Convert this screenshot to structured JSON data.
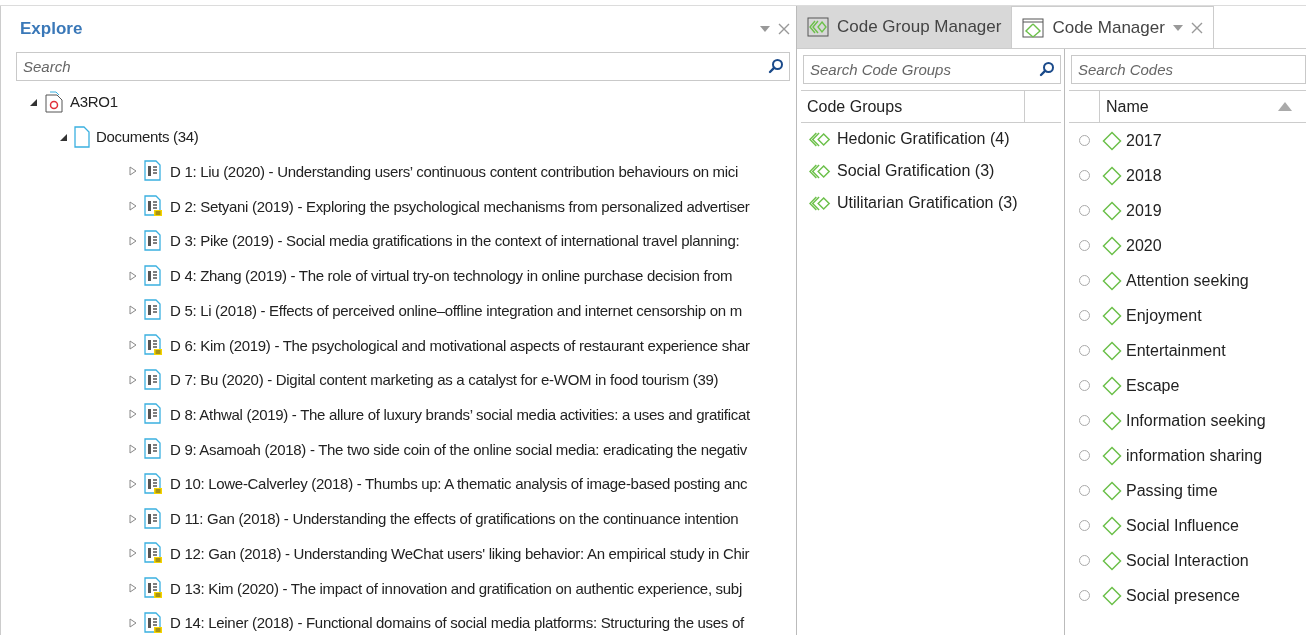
{
  "explore": {
    "title": "Explore",
    "search": {
      "placeholder": "Search"
    },
    "tree": [
      {
        "label": "A3RO1",
        "kind": "project",
        "expanded": true,
        "children": [
          {
            "label": "Documents (34)",
            "kind": "folder",
            "expanded": true,
            "children": [
              {
                "label": "D 1: Liu (2020) - Understanding users’ continuous content contribution behaviours on mici",
                "kind": "document",
                "expanded": false,
                "has_memo": false
              },
              {
                "label": "D 2: Setyani (2019) - Exploring the psychological mechanisms from personalized advertiser",
                "kind": "document",
                "expanded": false,
                "has_memo": true
              },
              {
                "label": "D 3: Pike (2019) - Social media gratifications in the context of international travel planning:",
                "kind": "document",
                "expanded": false,
                "has_memo": false
              },
              {
                "label": "D 4: Zhang (2019) - The role of virtual try-on technology in online purchase decision from",
                "kind": "document",
                "expanded": false,
                "has_memo": false
              },
              {
                "label": "D 5: Li (2018) - Effects of perceived online–offline integration and internet censorship on m",
                "kind": "document",
                "expanded": false,
                "has_memo": false
              },
              {
                "label": "D 6: Kim (2019) - The psychological and motivational aspects of restaurant experience shar",
                "kind": "document",
                "expanded": false,
                "has_memo": true
              },
              {
                "label": "D 7: Bu (2020) - Digital content marketing as a catalyst for e-WOM in food tourism (39)",
                "kind": "document",
                "expanded": false,
                "has_memo": false
              },
              {
                "label": "D 8: Athwal (2019) - The allure of luxury brands’ social media activities: a uses and gratificat",
                "kind": "document",
                "expanded": false,
                "has_memo": false
              },
              {
                "label": "D 9: Asamoah (2018) - The two side coin of the online social media: eradicating the negativ",
                "kind": "document",
                "expanded": false,
                "has_memo": false
              },
              {
                "label": "D 10: Lowe-Calverley (2018) - Thumbs up: A thematic analysis of image-based posting anc",
                "kind": "document",
                "expanded": false,
                "has_memo": true
              },
              {
                "label": "D 11: Gan (2018) - Understanding the effects of gratifications on the continuance intention",
                "kind": "document",
                "expanded": false,
                "has_memo": false
              },
              {
                "label": "D 12: Gan (2018) - Understanding WeChat users' liking behavior: An empirical study in Chir",
                "kind": "document",
                "expanded": false,
                "has_memo": true
              },
              {
                "label": "D 13: Kim (2020) - The impact of innovation and gratification on authentic experience, subj",
                "kind": "document",
                "expanded": false,
                "has_memo": true
              },
              {
                "label": "D 14: Leiner (2018) - Functional domains of social media platforms: Structuring the uses of",
                "kind": "document",
                "expanded": false,
                "has_memo": true
              }
            ]
          }
        ]
      }
    ]
  },
  "tabs": [
    {
      "label": "Code Group Manager",
      "kind": "groups",
      "selected": false
    },
    {
      "label": "Code Manager",
      "kind": "codes",
      "selected": true
    }
  ],
  "code_groups": {
    "search": {
      "placeholder": "Search Code Groups"
    },
    "column": "Code Groups",
    "items": [
      "Hedonic Gratification (4)",
      "Social Gratification (3)",
      "Utilitarian Gratification (3)"
    ]
  },
  "codes": {
    "search": {
      "placeholder": "Search Codes"
    },
    "column": "Name",
    "items": [
      "2017",
      "2018",
      "2019",
      "2020",
      "Attention seeking",
      "Enjoyment",
      "Entertainment",
      "Escape",
      "Information seeking",
      "information sharing",
      "Passing time",
      "Social Influence",
      "Social Interaction",
      "Social presence"
    ]
  }
}
